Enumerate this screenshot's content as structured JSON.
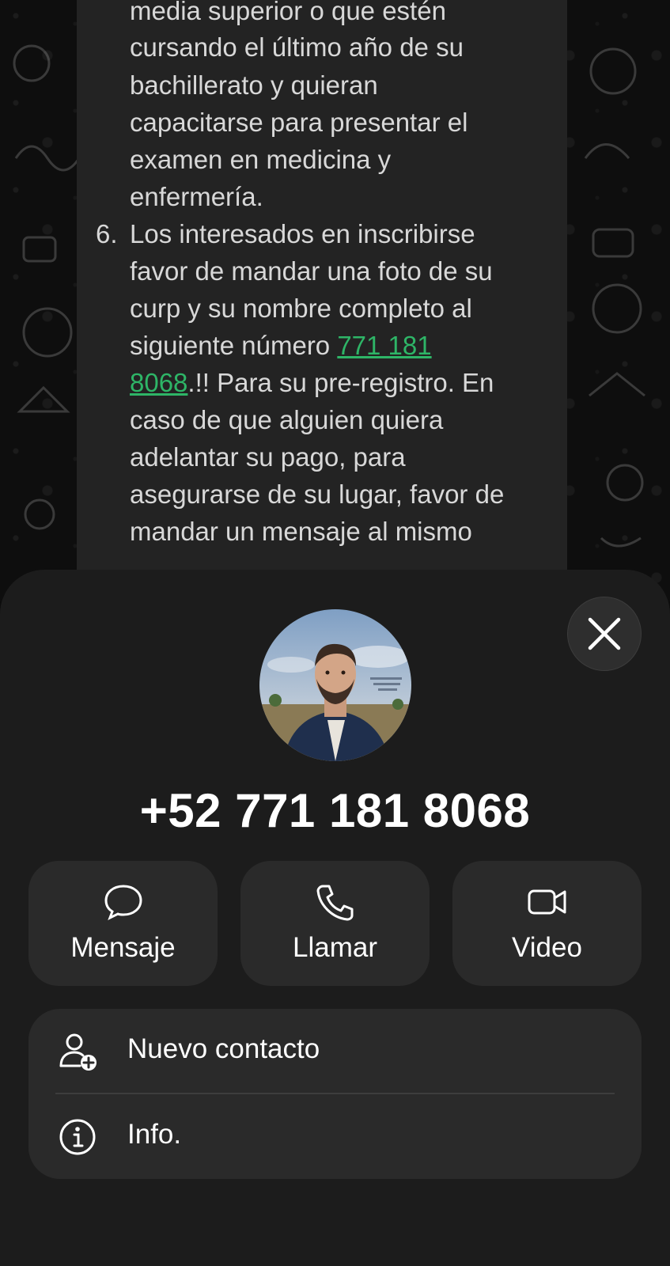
{
  "message": {
    "lines": [
      "media superior o que estén",
      "cursando el último año de su",
      "bachillerato y quieran",
      "capacitarse para presentar el",
      "examen en medicina y",
      "enfermería."
    ],
    "item_number": "6.",
    "item_line1": "Los interesados en inscribirse",
    "item_line2": "favor de mandar una foto de su",
    "item_line3": "curp y su nombre completo al",
    "item_line4_prefix": "siguiente número ",
    "phone_link_part1": "771 181",
    "phone_link_part2": "8068",
    "item_line5_suffix": ".!! Para su pre-registro. En",
    "item_line6": "caso de que alguien quiera",
    "item_line7": "adelantar su pago, para",
    "item_line8": "asegurarse de su lugar, favor de",
    "item_line9": "mandar un mensaje al mismo"
  },
  "contact": {
    "number": "+52 771 181 8068"
  },
  "actions": [
    {
      "label": "Mensaje",
      "icon": "chat-bubble-icon"
    },
    {
      "label": "Llamar",
      "icon": "phone-icon"
    },
    {
      "label": "Video",
      "icon": "video-camera-icon"
    }
  ],
  "options": [
    {
      "label": "Nuevo contacto",
      "icon": "add-contact-icon"
    },
    {
      "label": "Info.",
      "icon": "info-icon"
    }
  ],
  "colors": {
    "link": "#2eb567",
    "sheet": "#1c1c1c",
    "button": "#2a2a2a"
  }
}
